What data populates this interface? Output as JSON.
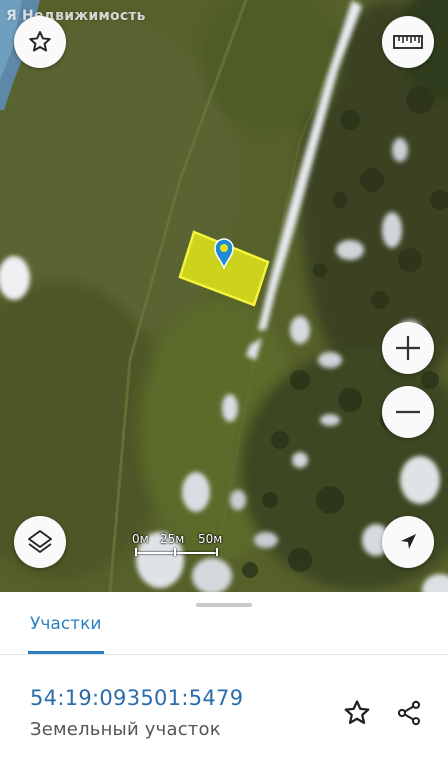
{
  "map": {
    "brand": "Я Недвижимость",
    "scale": {
      "label_0": "0м",
      "label_1": "25м",
      "label_2": "50м"
    },
    "controls": {
      "favorite": "star-icon",
      "ruler": "ruler-icon",
      "zoom_in": "plus-icon",
      "zoom_out": "minus-icon",
      "layers": "layers-icon",
      "locate": "navigation-arrow-icon"
    },
    "parcel_color": "#e2e61a",
    "pin_color": "#1f8ad6"
  },
  "sheet": {
    "tab_label": "Участки",
    "cadastral_number": "54:19:093501:5479",
    "object_type": "Земельный участок",
    "accent_color": "#2a80c3"
  }
}
